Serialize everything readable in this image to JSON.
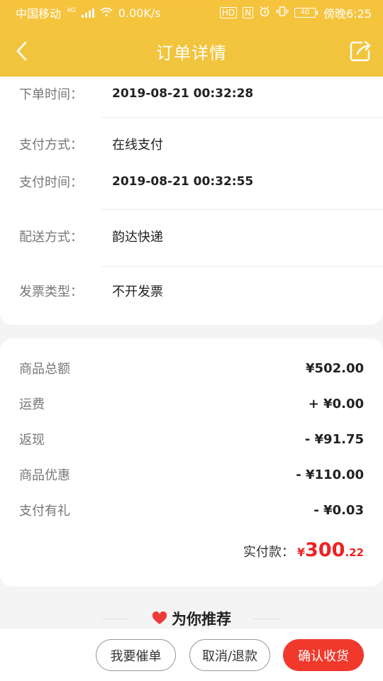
{
  "status_bar": {
    "carrier": "中国移动",
    "network": "4G",
    "speed": "0.00K/s",
    "hd": "HD",
    "nfc": "N",
    "battery": "40",
    "time": "傍晚6:25"
  },
  "nav": {
    "title": "订单详情",
    "back_icon": "chevron-left-icon",
    "share_icon": "share-icon"
  },
  "order_info": [
    {
      "label": "下单时间：",
      "value": "2019-08-21 00:32:28"
    },
    {
      "label": "支付方式：",
      "value": "在线支付"
    },
    {
      "label": "支付时间：",
      "value": "2019-08-21 00:32:55"
    },
    {
      "label": "配送方式：",
      "value": "韵达快递"
    },
    {
      "label": "发票类型：",
      "value": "不开发票"
    }
  ],
  "price_rows": [
    {
      "label": "商品总额",
      "amount": "¥502.00"
    },
    {
      "label": "运费",
      "amount": "+ ¥0.00"
    },
    {
      "label": "返现",
      "amount": "- ¥91.75"
    },
    {
      "label": "商品优惠",
      "amount": "- ¥110.00"
    },
    {
      "label": "支付有礼",
      "amount": "- ¥0.03"
    }
  ],
  "total": {
    "label": "实付款：",
    "currency": "¥",
    "integer": "300",
    "decimal": ".22"
  },
  "recommend": {
    "title": "为你推荐",
    "icon": "heart-icon"
  },
  "actions": {
    "remind": "我要催单",
    "cancel_refund": "取消/退款",
    "confirm_receipt": "确认收货"
  },
  "colors": {
    "header_yellow": "#f4c63c",
    "accent_red": "#f0382b",
    "price_red": "#ee2222"
  }
}
